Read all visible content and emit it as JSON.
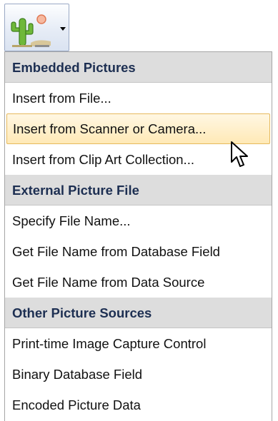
{
  "toolbar": {
    "picture_button_icon": "picture-cactus-icon",
    "dropdown_icon": "chevron-down-icon"
  },
  "menu": {
    "sections": [
      {
        "header": "Embedded Pictures",
        "items": [
          {
            "label": "Insert from File..."
          },
          {
            "label": "Insert from Scanner or Camera...",
            "highlighted": true
          },
          {
            "label": "Insert from Clip Art Collection..."
          }
        ]
      },
      {
        "header": "External Picture File",
        "items": [
          {
            "label": "Specify File Name..."
          },
          {
            "label": "Get File Name from Database Field"
          },
          {
            "label": "Get File Name from Data Source"
          }
        ]
      },
      {
        "header": "Other Picture Sources",
        "items": [
          {
            "label": "Print-time Image Capture Control"
          },
          {
            "label": "Binary Database Field"
          },
          {
            "label": "Encoded Picture Data"
          }
        ]
      }
    ]
  },
  "colors": {
    "highlight_fill": "#ffe9b6",
    "highlight_border": "#e6b95c",
    "header_fill": "#dddddd",
    "header_text": "#1d2f52"
  }
}
